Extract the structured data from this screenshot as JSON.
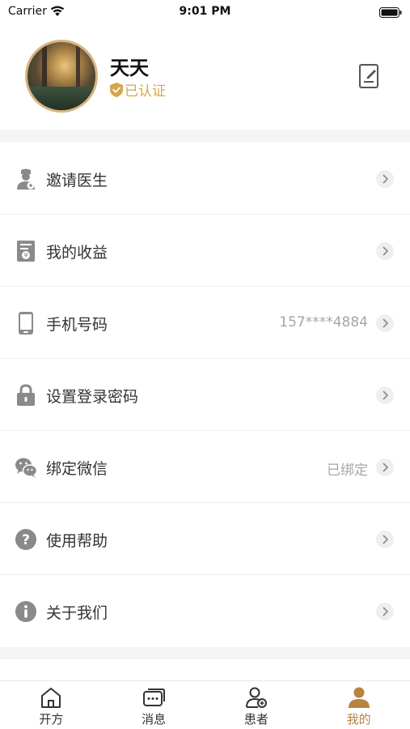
{
  "status_bar": {
    "carrier": "Carrier",
    "time": "9:01 PM"
  },
  "profile": {
    "name": "天天",
    "verified_label": "已认证"
  },
  "menu": [
    {
      "label": "邀请医生",
      "value": ""
    },
    {
      "label": "我的收益",
      "value": ""
    },
    {
      "label": "手机号码",
      "value": "157****4884"
    },
    {
      "label": "设置登录密码",
      "value": ""
    },
    {
      "label": "绑定微信",
      "value": "已绑定"
    },
    {
      "label": "使用帮助",
      "value": ""
    },
    {
      "label": "关于我们",
      "value": ""
    }
  ],
  "tabs": [
    {
      "label": "开方",
      "icon": "house-icon",
      "active": false
    },
    {
      "label": "消息",
      "icon": "message-icon",
      "active": false
    },
    {
      "label": "患者",
      "icon": "patient-icon",
      "active": false
    },
    {
      "label": "我的",
      "icon": "person-icon",
      "active": true
    }
  ],
  "colors": {
    "accent": "#b98340",
    "verified": "#d6a64a",
    "icon_gray": "#8a8a8a",
    "value_gray": "#a6a6a6"
  }
}
